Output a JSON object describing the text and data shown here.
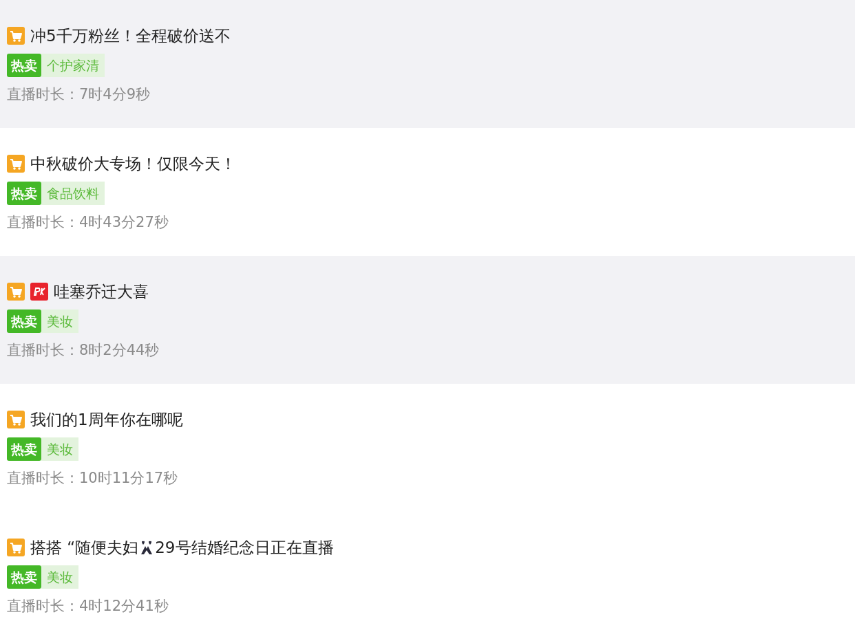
{
  "streams": [
    {
      "shaded": true,
      "badges": [
        {
          "kind": "cart"
        }
      ],
      "title": [
        "冲5千万粉丝！全程破价送不"
      ],
      "hot_tag": "热卖",
      "category": "个护家清",
      "duration_label": "直播时长：",
      "duration": "7时4分9秒"
    },
    {
      "shaded": false,
      "badges": [
        {
          "kind": "cart"
        }
      ],
      "title": [
        "中秋破价大专场！仅限今天！"
      ],
      "hot_tag": "热卖",
      "category": "食品饮料",
      "duration_label": "直播时长：",
      "duration": "4时43分27秒"
    },
    {
      "shaded": true,
      "badges": [
        {
          "kind": "cart"
        },
        {
          "kind": "pk"
        }
      ],
      "title": [
        "哇塞乔迁大喜"
      ],
      "hot_tag": "热卖",
      "category": "美妆",
      "duration_label": "直播时长：",
      "duration": "8时2分44秒"
    },
    {
      "shaded": false,
      "badges": [
        {
          "kind": "cart"
        }
      ],
      "title": [
        "我们的1周年你在哪呢"
      ],
      "hot_tag": "热卖",
      "category": "美妆",
      "duration_label": "直播时长：",
      "duration": "10时11分17秒"
    },
    {
      "shaded": false,
      "badges": [
        {
          "kind": "cart"
        }
      ],
      "title": [
        "搭搭 “随便夫妇",
        "29号结婚纪念日正在直播"
      ],
      "hot_tag": "热卖",
      "category": "美妆",
      "duration_label": "直播时长：",
      "duration": "4时12分41秒"
    }
  ]
}
